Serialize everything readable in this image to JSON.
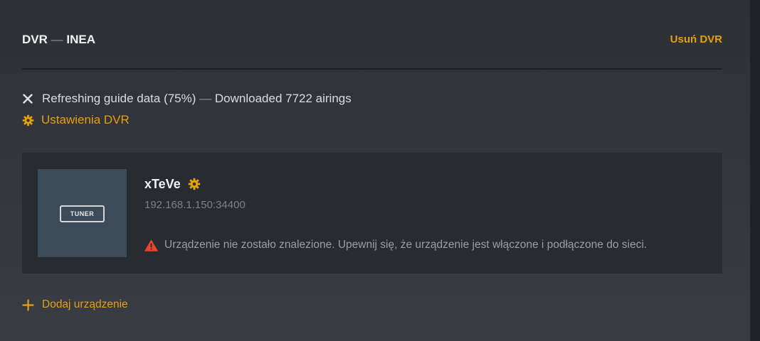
{
  "dvr": {
    "title_prefix": "DVR",
    "title_separator": "—",
    "title_name": "INEA",
    "remove_label": "Usuń DVR"
  },
  "status": {
    "icon": "close-icon",
    "refresh_text": "Refreshing guide data (75%)",
    "separator": "—",
    "download_text": "Downloaded 7722 airings"
  },
  "settings": {
    "icon": "gear-icon",
    "label": "Ustawienia DVR"
  },
  "device": {
    "thumbnail_badge": "TUNER",
    "name": "xTeVe",
    "settings_icon": "gear-icon",
    "address": "192.168.1.150:34400",
    "warning_icon": "warning-icon",
    "warning_text": "Urządzenie nie zostało znalezione. Upewnij się, że urządzenie jest włączone i podłączone do sieci."
  },
  "add_device": {
    "icon": "plus-icon",
    "label": "Dodaj urządzenie"
  },
  "colors": {
    "accent": "#e5a00d",
    "warning": "#e5462e",
    "background": "#33373d",
    "card": "#282b2f",
    "thumbnail": "#3d4a58"
  }
}
